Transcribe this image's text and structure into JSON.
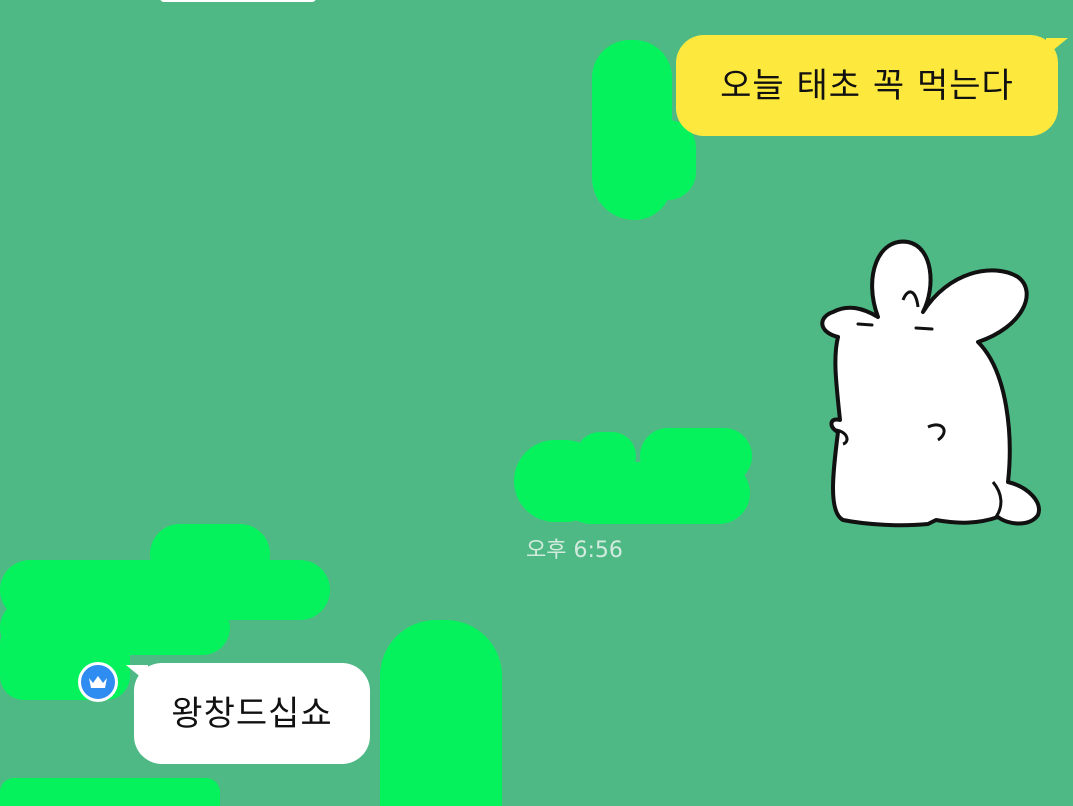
{
  "messages": {
    "outgoing": {
      "text": "오늘 태초 꼭 먹는다"
    },
    "incoming": {
      "text": "왕창드십쇼"
    }
  },
  "timestamp": "오후 6:56",
  "sticker": {
    "name": "white-rabbit-sticker"
  },
  "badge": {
    "icon": "crown-icon"
  },
  "colors": {
    "background": "#4fb985",
    "outgoing_bubble": "#fde93e",
    "incoming_bubble": "#ffffff",
    "redaction": "#05f25d",
    "badge": "#2f8cf0"
  }
}
